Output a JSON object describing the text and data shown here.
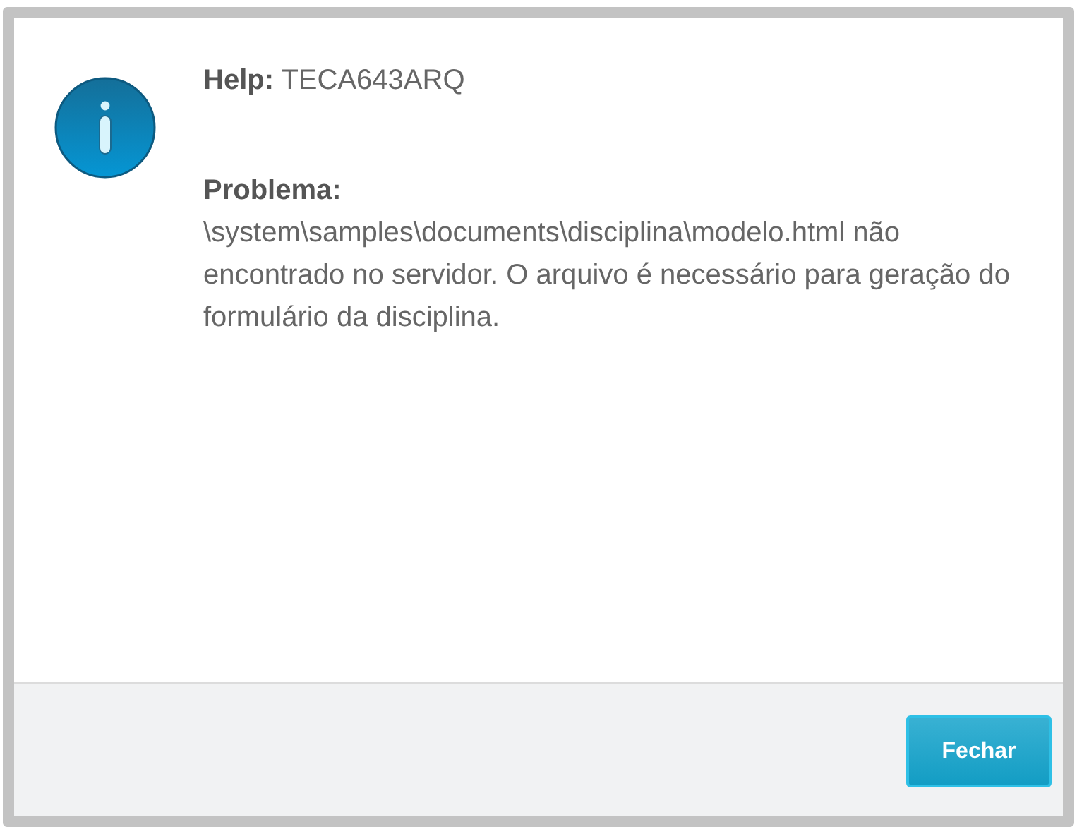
{
  "dialog": {
    "title_label": "Help:",
    "title_code": "TECA643ARQ",
    "heading": "Problema:",
    "message": "\\system\\samples\\documents\\disciplina\\modelo.html não encontrado no servidor. O arquivo é necessário para geração do formulário da disciplina.",
    "buttons": [
      {
        "label": "Fechar",
        "kind": "primary"
      }
    ]
  }
}
